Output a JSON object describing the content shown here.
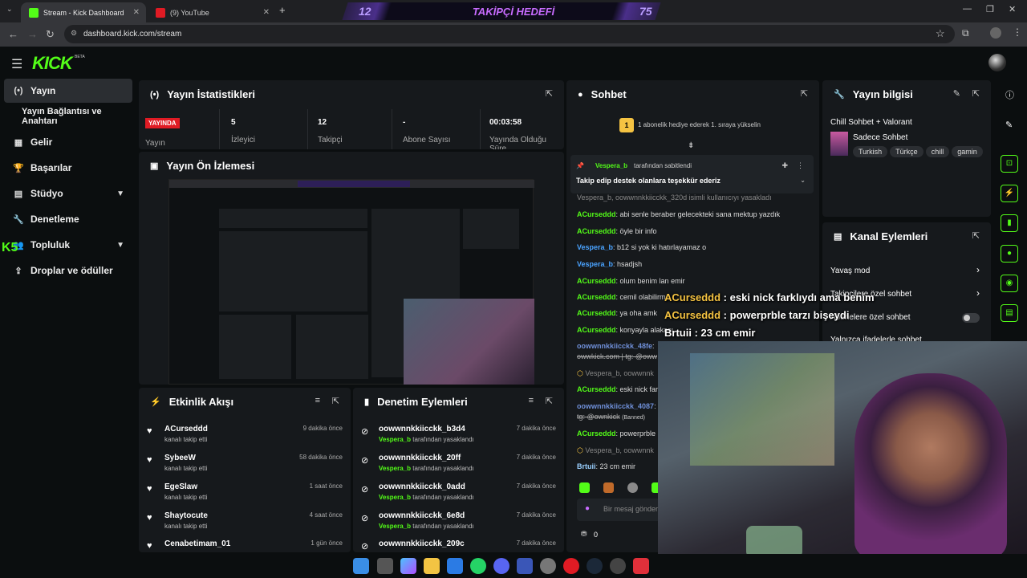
{
  "browser": {
    "tabs": [
      {
        "title": "Stream - Kick Dashboard",
        "active": true
      },
      {
        "title": "(9) YouTube",
        "active": false
      }
    ],
    "url": "dashboard.kick.com/stream"
  },
  "follow_goal": {
    "current": "12",
    "title": "TAKİPÇİ HEDEFİ",
    "target": "75"
  },
  "kick": {
    "logo": "KICK",
    "beta": "BETA"
  },
  "sidebar": {
    "items": [
      {
        "label": "Yayın",
        "icon": "broadcast-icon"
      },
      {
        "label": "Yayın Bağlantısı ve Anahtarı"
      },
      {
        "label": "Gelir",
        "icon": "chart-icon"
      },
      {
        "label": "Başarılar",
        "icon": "trophy-icon"
      },
      {
        "label": "Stüdyo",
        "icon": "studio-icon"
      },
      {
        "label": "Denetleme",
        "icon": "wrench-icon"
      },
      {
        "label": "Topluluk",
        "icon": "community-icon"
      },
      {
        "label": "Droplar ve ödüller",
        "icon": "drops-icon"
      }
    ],
    "overlay_badge": "K5"
  },
  "stats": {
    "title": "Yayın İstatistikleri",
    "live": "YAYINDA",
    "live_label": "Yayın",
    "viewers_value": "5",
    "viewers_label": "İzleyici",
    "followers_value": "12",
    "followers_label": "Takipçi",
    "subs_value": "-",
    "subs_label": "Abone Sayısı",
    "uptime_value": "00:03:58",
    "uptime_label": "Yayında Olduğu Süre"
  },
  "preview": {
    "title": "Yayın Ön İzlemesi"
  },
  "activity": {
    "title": "Etkinlik Akışı",
    "items": [
      {
        "name": "ACurseddd",
        "sub": "kanalı takip etti",
        "time": "9 dakika önce"
      },
      {
        "name": "SybeeW",
        "sub": "kanalı takip etti",
        "time": "58 dakika önce"
      },
      {
        "name": "EgeSlaw",
        "sub": "kanalı takip etti",
        "time": "1 saat önce"
      },
      {
        "name": "Shaytocute",
        "sub": "kanalı takip etti",
        "time": "4 saat önce"
      },
      {
        "name": "Cenabetimam_01",
        "sub": "",
        "time": "1 gün önce"
      }
    ]
  },
  "moderation": {
    "title": "Denetim Eylemleri",
    "items": [
      {
        "name": "oowwnnkkiicckk_b3d4",
        "sub": "tarafından yasaklandı",
        "mod": "Vespera_b",
        "time": "7 dakika önce"
      },
      {
        "name": "oowwnnkkiicckk_20ff",
        "sub": "tarafından yasaklandı",
        "mod": "Vespera_b",
        "time": "7 dakika önce"
      },
      {
        "name": "oowwnnkkiicckk_0add",
        "sub": "tarafından yasaklandı",
        "mod": "Vespera_b",
        "time": "7 dakika önce"
      },
      {
        "name": "oowwnnkkiicckk_6e8d",
        "sub": "tarafından yasaklandı",
        "mod": "Vespera_b",
        "time": "7 dakika önce"
      },
      {
        "name": "oowwnnkkiicckk_209c",
        "sub": "",
        "mod": "",
        "time": "7 dakika önce"
      }
    ]
  },
  "chat": {
    "title": "Sohbet",
    "gift_text": "1 abonelik hediye ederek 1. sıraya yükselin",
    "gift_rank": "1",
    "pinned_by": "Vespera_b",
    "pinned_by_suffix": "tarafından sabitlendi",
    "pinned_text": "Takip edip destek olanlara teşekkür ederiz",
    "messages": [
      {
        "user": "Vespera_b, oowwnnkkiicckk_320d",
        "text": "isimli kullanıcıyı yasakladı",
        "kind": "system"
      },
      {
        "user": "ACurseddd",
        "text": "abi senle beraber gelecekteki sana mektup yazdık",
        "kind": "normal"
      },
      {
        "user": "ACurseddd",
        "text": "öyle bir info",
        "kind": "normal"
      },
      {
        "user": "Vespera_b",
        "text": "b12 si yok ki hatırlayamaz o",
        "kind": "mod"
      },
      {
        "user": "Vespera_b",
        "text": "hsadjsh",
        "kind": "mod"
      },
      {
        "user": "ACurseddd",
        "text": "olum benim lan emir",
        "kind": "normal"
      },
      {
        "user": "ACurseddd",
        "text": "cemil olabilirm",
        "kind": "normal"
      },
      {
        "user": "ACurseddd",
        "text": "ya oha amk",
        "kind": "normal"
      },
      {
        "user": "ACurseddd",
        "text": "konyayla alakası",
        "kind": "normal"
      },
      {
        "user": "oowwnnkkiicckk_48fe",
        "text": "",
        "kind": "banned1"
      },
      {
        "user": "",
        "text": "owwkick.com | tg: @oww",
        "kind": "banned2"
      },
      {
        "user": "Vespera_b, oowwnnk",
        "text": "",
        "kind": "system"
      },
      {
        "user": "ACurseddd",
        "text": "eski nick far",
        "kind": "normal"
      },
      {
        "user": "oowwnnkkiicckk_4087",
        "text": "",
        "kind": "banned1"
      },
      {
        "user": "",
        "text": "tg: @ownkick",
        "kind": "banned3"
      },
      {
        "user": "ACurseddd",
        "text": "powerprble",
        "kind": "normal"
      },
      {
        "user": "Vespera_b, oowwnnk",
        "text": "",
        "kind": "system"
      },
      {
        "user": "Brtuii",
        "text": "23 cm emir",
        "kind": "plain"
      }
    ],
    "banned_label": "(Banned)",
    "input_placeholder": "Bir mesaj gönder",
    "footer_count": "0"
  },
  "stream_info": {
    "title": "Yayın bilgisi",
    "stream_title": "Chill Sohbet + Valorant",
    "category": "Sadece Sohbet",
    "tags": [
      "Turkish",
      "Türkçe",
      "chill",
      "gamin"
    ]
  },
  "channel_actions": {
    "title": "Kanal Eylemleri",
    "items": [
      {
        "label": "Yavaş mod",
        "control": "chevron"
      },
      {
        "label": "Takipçilere özel sohbet",
        "control": "chevron"
      },
      {
        "label": "Abonelere özel sohbet",
        "control": "toggle"
      },
      {
        "label": "Yalnızca ifadelerle sohbet",
        "control": "toggle"
      }
    ]
  },
  "overlay_chat": [
    {
      "user": "ACurseddd",
      "text": "eski nick farklıydı ama benim"
    },
    {
      "user": "ACurseddd",
      "text": "powerprble tarzı bişeydi"
    },
    {
      "user": "Brtuii",
      "text": "23 cm emir"
    }
  ],
  "colors": {
    "accent": "#53fc18",
    "live": "#e01b24",
    "mod": "#4aa3ff",
    "goal": "#c86cff"
  }
}
